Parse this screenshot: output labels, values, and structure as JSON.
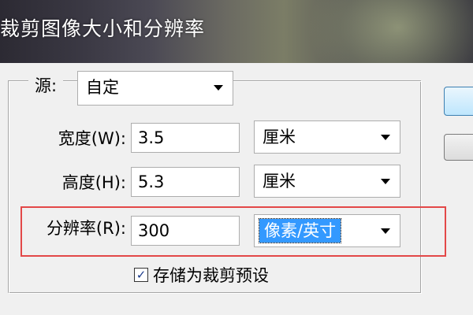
{
  "window": {
    "title": "裁剪图像大小和分辨率"
  },
  "dialog": {
    "source": {
      "label": "源:",
      "value": "自定"
    },
    "width": {
      "label": "宽度(W):",
      "value": "3.5",
      "unit": "厘米"
    },
    "height": {
      "label": "高度(H):",
      "value": "5.3",
      "unit": "厘米"
    },
    "resolution": {
      "label": "分辨率(R):",
      "value": "300",
      "unit": "像素/英寸"
    },
    "save_preset": {
      "label": "存储为裁剪预设",
      "checked": true,
      "check_glyph": "✓"
    }
  },
  "colors": {
    "highlight_border": "#e34848",
    "selected_bg": "#3399ff"
  }
}
